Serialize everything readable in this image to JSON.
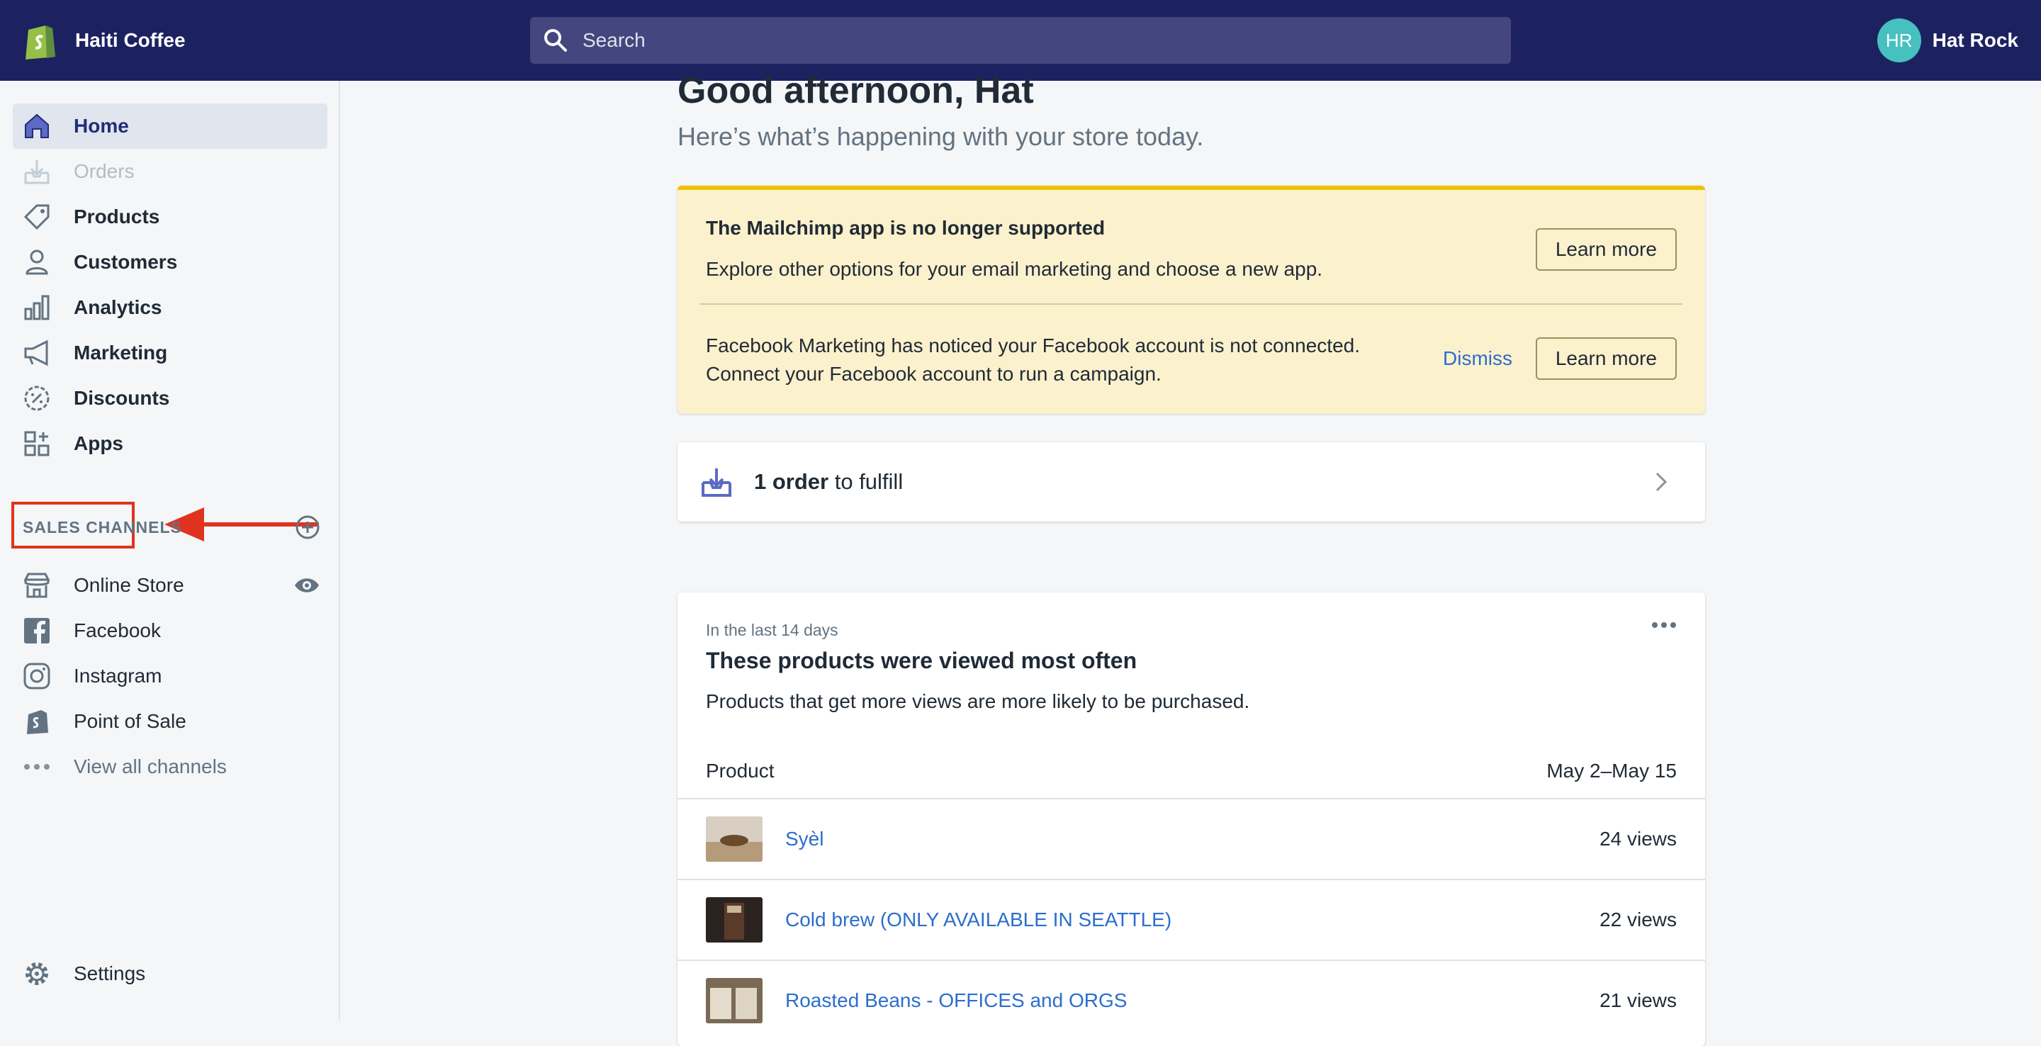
{
  "topbar": {
    "store_name": "Haiti Coffee",
    "search_placeholder": "Search",
    "user_initials": "HR",
    "user_name": "Hat Rock"
  },
  "sidebar": {
    "items": [
      {
        "label": "Home",
        "icon": "home-icon"
      },
      {
        "label": "Orders",
        "icon": "orders-icon"
      },
      {
        "label": "Products",
        "icon": "tag-icon"
      },
      {
        "label": "Customers",
        "icon": "person-icon"
      },
      {
        "label": "Analytics",
        "icon": "bar-chart-icon"
      },
      {
        "label": "Marketing",
        "icon": "megaphone-icon"
      },
      {
        "label": "Discounts",
        "icon": "discount-icon"
      },
      {
        "label": "Apps",
        "icon": "apps-icon"
      }
    ],
    "sales_channels_title": "SALES CHANNELS",
    "channels": [
      {
        "label": "Online Store",
        "icon": "store-icon"
      },
      {
        "label": "Facebook",
        "icon": "facebook-icon"
      },
      {
        "label": "Instagram",
        "icon": "instagram-icon"
      },
      {
        "label": "Point of Sale",
        "icon": "pos-icon"
      },
      {
        "label": "View all channels",
        "icon": "more-icon"
      }
    ],
    "settings_label": "Settings"
  },
  "main": {
    "greeting": "Good afternoon, Hat",
    "subgreeting": "Here’s what’s happening with your store today.",
    "banner": {
      "title": "The Mailchimp app is no longer supported",
      "text": "Explore other options for your email marketing and choose a new app.",
      "learn_more_1": "Learn more",
      "fb_line1": "Facebook Marketing has noticed your Facebook account is not connected.",
      "fb_line2": "Connect your Facebook account to run a campaign.",
      "dismiss": "Dismiss",
      "learn_more_2": "Learn more"
    },
    "orders": {
      "count": "1 order",
      "suffix": " to fulfill"
    },
    "products_card": {
      "pre": "In the last 14 days",
      "title": "These products were viewed most often",
      "desc": "Products that get more views are more likely to be purchased.",
      "col_product": "Product",
      "col_range": "May 2–May 15",
      "rows": [
        {
          "name": "Syèl",
          "views": "24 views"
        },
        {
          "name": "Cold brew (ONLY AVAILABLE IN SEATTLE)",
          "views": "22 views"
        },
        {
          "name": "Roasted Beans - OFFICES and ORGS",
          "views": "21 views"
        }
      ]
    }
  },
  "colors": {
    "topbar": "#1c2260",
    "accent": "#202e78",
    "link": "#2c6ecb",
    "banner_bg": "#fcf1cd",
    "highlight": "#e0331f"
  }
}
